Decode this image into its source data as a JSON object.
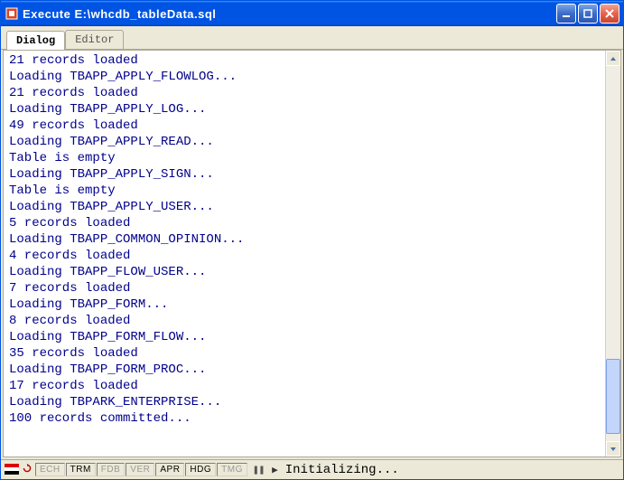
{
  "window": {
    "title": "Execute E:\\whcdb_tableData.sql"
  },
  "tabs": {
    "items": [
      {
        "label": "Dialog",
        "active": true
      },
      {
        "label": "Editor",
        "active": false
      }
    ]
  },
  "log": {
    "lines": [
      "21 records loaded",
      "Loading TBAPP_APPLY_FLOWLOG...",
      "21 records loaded",
      "Loading TBAPP_APPLY_LOG...",
      "49 records loaded",
      "Loading TBAPP_APPLY_READ...",
      "Table is empty",
      "Loading TBAPP_APPLY_SIGN...",
      "Table is empty",
      "Loading TBAPP_APPLY_USER...",
      "5 records loaded",
      "Loading TBAPP_COMMON_OPINION...",
      "4 records loaded",
      "Loading TBAPP_FLOW_USER...",
      "7 records loaded",
      "Loading TBAPP_FORM...",
      "8 records loaded",
      "Loading TBAPP_FORM_FLOW...",
      "35 records loaded",
      "Loading TBAPP_FORM_PROC...",
      "17 records loaded",
      "Loading TBPARK_ENTERPRISE...",
      "100 records committed..."
    ]
  },
  "status": {
    "segments": [
      {
        "label": "ECH",
        "dim": true
      },
      {
        "label": "TRM",
        "dim": false
      },
      {
        "label": "FDB",
        "dim": true
      },
      {
        "label": "VER",
        "dim": true
      },
      {
        "label": "APR",
        "dim": false
      },
      {
        "label": "HDG",
        "dim": false
      },
      {
        "label": "TMG",
        "dim": true
      }
    ],
    "pause": "❚❚",
    "arrow": "▶",
    "message": "Initializing..."
  }
}
